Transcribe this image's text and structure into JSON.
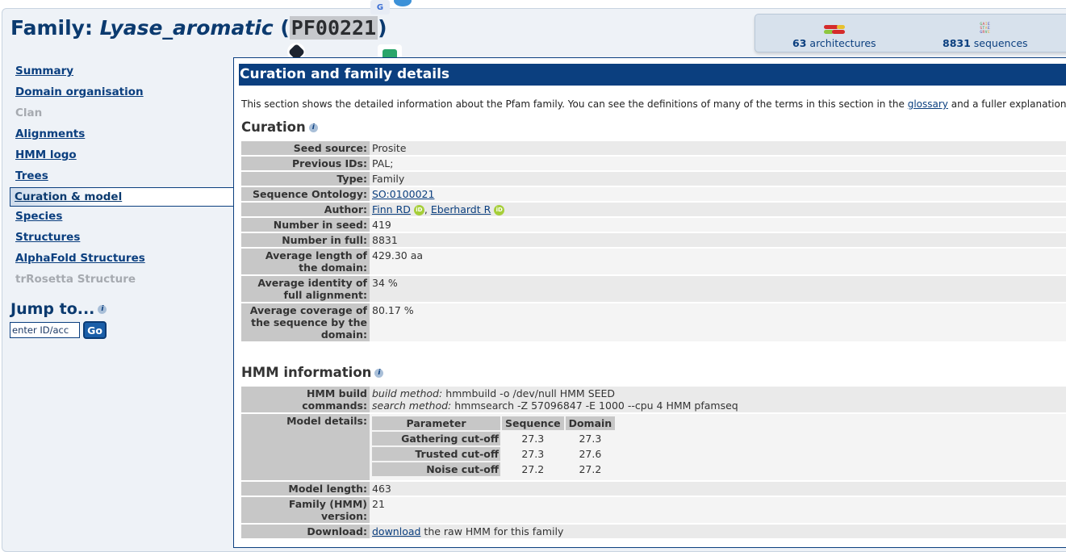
{
  "title": {
    "prefix": "Family: ",
    "name": "Lyase_aromatic",
    "open_paren": " (",
    "accession": "PF00221",
    "close_paren": ")"
  },
  "stats": {
    "architectures_count": "63",
    "architectures_label": "architectures",
    "sequences_count": "8831",
    "sequences_label": "sequences"
  },
  "sidebar": {
    "items": [
      {
        "label": "Summary",
        "state": "normal"
      },
      {
        "label": "Domain organisation",
        "state": "normal"
      },
      {
        "label": "Clan",
        "state": "disabled"
      },
      {
        "label": "Alignments",
        "state": "normal"
      },
      {
        "label": "HMM logo",
        "state": "normal"
      },
      {
        "label": "Trees",
        "state": "normal"
      },
      {
        "label": "Curation & model",
        "state": "active"
      },
      {
        "label": "Species",
        "state": "normal"
      },
      {
        "label": "Structures",
        "state": "normal"
      },
      {
        "label": "AlphaFold Structures",
        "state": "normal"
      },
      {
        "label": "trRosetta Structure",
        "state": "disabled"
      }
    ],
    "jump_heading": "Jump to...",
    "jump_placeholder": "enter ID/acc",
    "go_label": "Go"
  },
  "main": {
    "section_title": "Curation and family details",
    "intro_before": "This section shows the detailed information about the Pfam family. You can see the definitions of many of the terms in this section in the ",
    "intro_link": "glossary",
    "intro_after": " and a fuller explanation",
    "curation_heading": "Curation",
    "curation": {
      "seed_source_label": "Seed source:",
      "seed_source": "Prosite",
      "previous_ids_label": "Previous IDs:",
      "previous_ids": "PAL;",
      "type_label": "Type:",
      "type": "Family",
      "sequence_ontology_label": "Sequence Ontology:",
      "sequence_ontology": "SO:0100021",
      "author_label": "Author:",
      "author_1": "Finn RD",
      "author_sep": ", ",
      "author_2": "Eberhardt R",
      "orcid_text": "iD",
      "number_in_seed_label": "Number in seed:",
      "number_in_seed": "419",
      "number_in_full_label": "Number in full:",
      "number_in_full": "8831",
      "avg_length_label": "Average length of the domain:",
      "avg_length": "429.30 aa",
      "avg_identity_label": "Average identity of full alignment:",
      "avg_identity": "34 %",
      "avg_coverage_label": "Average coverage of the sequence by the domain:",
      "avg_coverage": "80.17 %"
    },
    "hmm_heading": "HMM information",
    "hmm": {
      "build_commands_label": "HMM build commands:",
      "build_method_label": "build method:",
      "build_method": "hmmbuild -o /dev/null HMM SEED",
      "search_method_label": "search method:",
      "search_method": "hmmsearch -Z 57096847 -E 1000 --cpu 4 HMM pfamseq",
      "model_details_label": "Model details:",
      "param_headers": [
        "Parameter",
        "Sequence",
        "Domain"
      ],
      "params": [
        {
          "name": "Gathering cut-off",
          "sequence": "27.3",
          "domain": "27.3"
        },
        {
          "name": "Trusted cut-off",
          "sequence": "27.3",
          "domain": "27.6"
        },
        {
          "name": "Noise cut-off",
          "sequence": "27.2",
          "domain": "27.2"
        }
      ],
      "model_length_label": "Model length:",
      "model_length": "463",
      "family_version_label": "Family (HMM) version:",
      "family_version": "21",
      "download_label": "Download:",
      "download_link": "download",
      "download_after": " the raw HMM for this family"
    }
  },
  "colors": {
    "brand_blue": "#0b3f7f",
    "orcid_green": "#a6ce39",
    "row_header_gray": "#c7c7c7"
  }
}
